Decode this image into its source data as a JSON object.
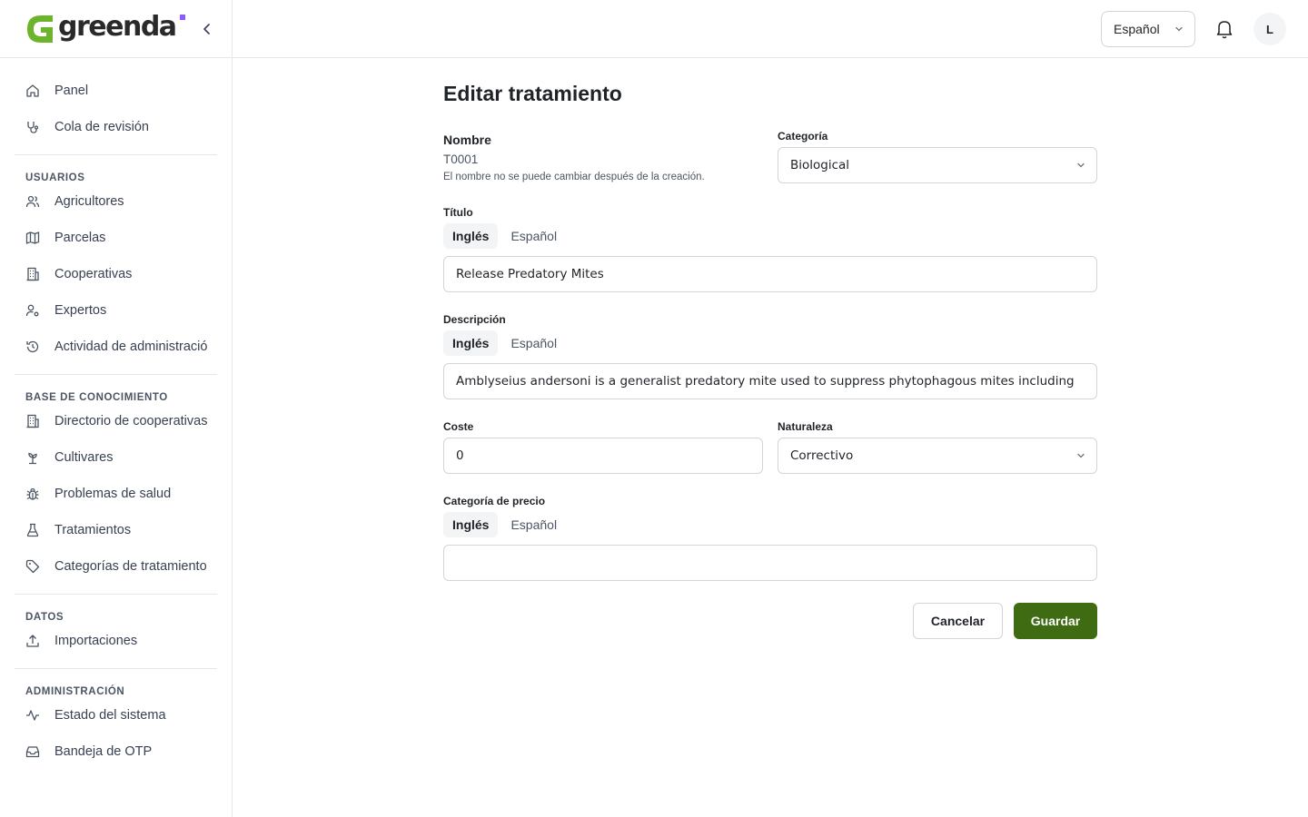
{
  "brand": {
    "name": "greenda",
    "accent": "#3f6b12",
    "logo_green": "#6bb42b",
    "dot_color": "#8b5cf6"
  },
  "sidebar": {
    "collapse_icon": "chevron-left-icon",
    "items_top": [
      {
        "label": "Panel",
        "icon": "home-icon"
      },
      {
        "label": "Cola de revisión",
        "icon": "stethoscope-icon"
      }
    ],
    "sections": [
      {
        "title": "USUARIOS",
        "items": [
          {
            "label": "Agricultores",
            "icon": "users-icon"
          },
          {
            "label": "Parcelas",
            "icon": "map-icon"
          },
          {
            "label": "Cooperativas",
            "icon": "building-icon"
          },
          {
            "label": "Expertos",
            "icon": "user-cog-icon"
          },
          {
            "label": "Actividad de administración",
            "icon": "history-icon"
          }
        ]
      },
      {
        "title": "BASE DE CONOCIMIENTO",
        "items": [
          {
            "label": "Directorio de cooperativas",
            "icon": "building-icon"
          },
          {
            "label": "Cultivares",
            "icon": "sprout-icon"
          },
          {
            "label": "Problemas de salud",
            "icon": "bug-icon"
          },
          {
            "label": "Tratamientos",
            "icon": "flask-icon"
          },
          {
            "label": "Categorías de tratamiento",
            "icon": "tag-icon"
          }
        ]
      },
      {
        "title": "DATOS",
        "items": [
          {
            "label": "Importaciones",
            "icon": "upload-icon"
          }
        ]
      },
      {
        "title": "ADMINISTRACIÓN",
        "items": [
          {
            "label": "Estado del sistema",
            "icon": "activity-icon"
          },
          {
            "label": "Bandeja de OTP",
            "icon": "inbox-icon"
          }
        ]
      }
    ]
  },
  "topbar": {
    "language": "Español",
    "notifications_icon": "bell-icon",
    "avatar_initial": "L"
  },
  "form": {
    "title": "Editar tratamiento",
    "name": {
      "label": "Nombre",
      "value": "T0001",
      "hint": "El nombre no se puede cambiar después de la creación."
    },
    "category": {
      "label": "Categoría",
      "value": "Biological"
    },
    "title_field": {
      "label": "Título",
      "tabs": [
        "Inglés",
        "Español"
      ],
      "active_tab": "Inglés",
      "value": "Release Predatory Mites"
    },
    "description": {
      "label": "Descripción",
      "tabs": [
        "Inglés",
        "Español"
      ],
      "active_tab": "Inglés",
      "value": "Amblyseius andersoni is a generalist predatory mite used to suppress phytophagous mites including"
    },
    "cost": {
      "label": "Coste",
      "value": "0"
    },
    "nature": {
      "label": "Naturaleza",
      "value": "Correctivo"
    },
    "price_category": {
      "label": "Categoría de precio",
      "tabs": [
        "Inglés",
        "Español"
      ],
      "active_tab": "Inglés",
      "value": ""
    },
    "cancel_label": "Cancelar",
    "save_label": "Guardar"
  }
}
